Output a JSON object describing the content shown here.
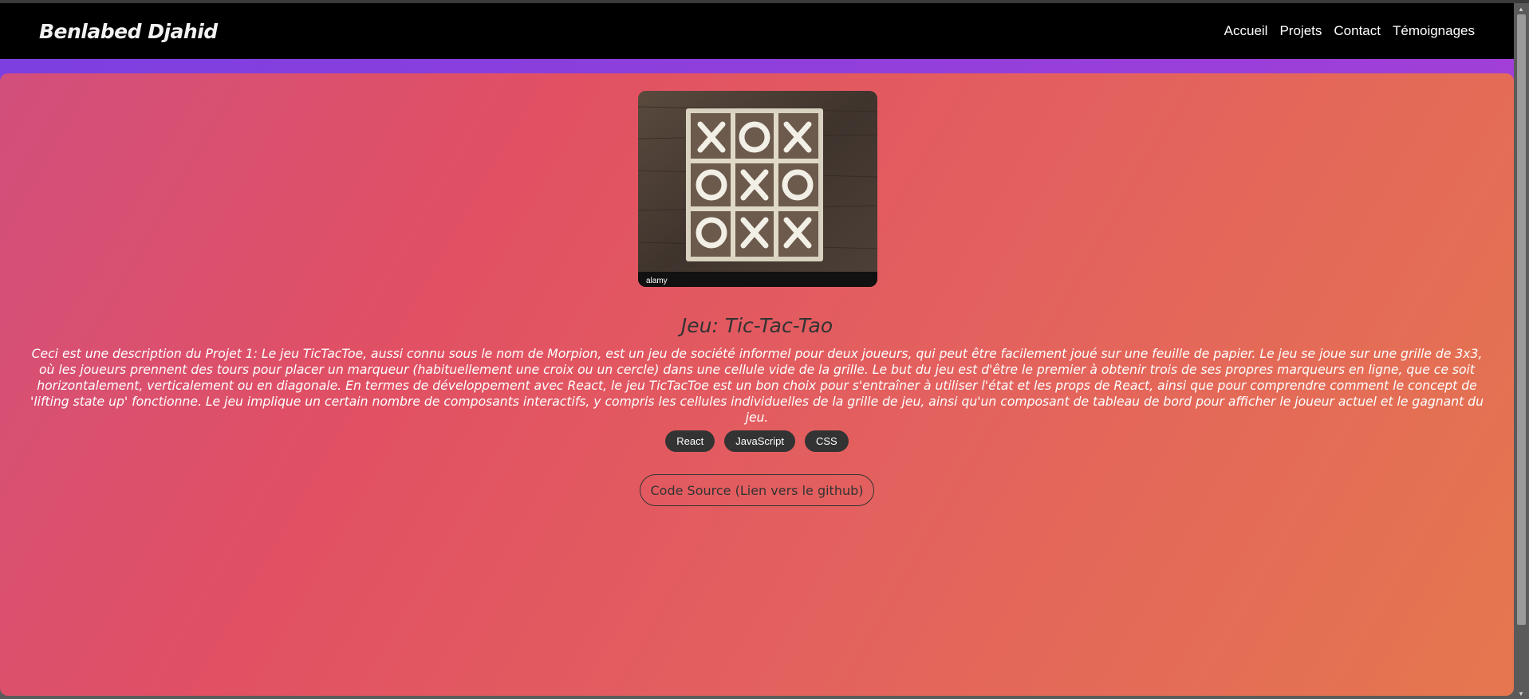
{
  "header": {
    "brand": "Benlabed Djahid",
    "nav": [
      "Accueil",
      "Projets",
      "Contact",
      "Témoignages"
    ]
  },
  "project": {
    "image_icon": "tic-tac-toe-board-image",
    "image_watermark": "alamy",
    "title": "Jeu: Tic-Tac-Tao",
    "description": "Ceci est une description du Projet 1: Le jeu TicTacToe, aussi connu sous le nom de Morpion, est un jeu de société informel pour deux joueurs, qui peut être facilement joué sur une feuille de papier. Le jeu se joue sur une grille de 3x3, où les joueurs prennent des tours pour placer un marqueur (habituellement une croix ou un cercle) dans une cellule vide de la grille. Le but du jeu est d'être le premier à obtenir trois de ses propres marqueurs en ligne, que ce soit horizontalement, verticalement ou en diagonale. En termes de développement avec React, le jeu TicTacToe est un bon choix pour s'entraîner à utiliser l'état et les props de React, ainsi que pour comprendre comment le concept de 'lifting state up' fonctionne. Le jeu implique un certain nombre de composants interactifs, y compris les cellules individuelles de la grille de jeu, ainsi qu'un composant de tableau de bord pour afficher le joueur actuel et le gagnant du jeu.",
    "tags": [
      "React",
      "JavaScript",
      "CSS"
    ],
    "source_button": "Code Source (Lien vers le github)"
  },
  "colors": {
    "navbar": "#000000",
    "accent_band": "#8a3fe0",
    "gradient_start": "#d24f7c",
    "gradient_end": "#e5774f",
    "tag_bg": "#333333"
  }
}
